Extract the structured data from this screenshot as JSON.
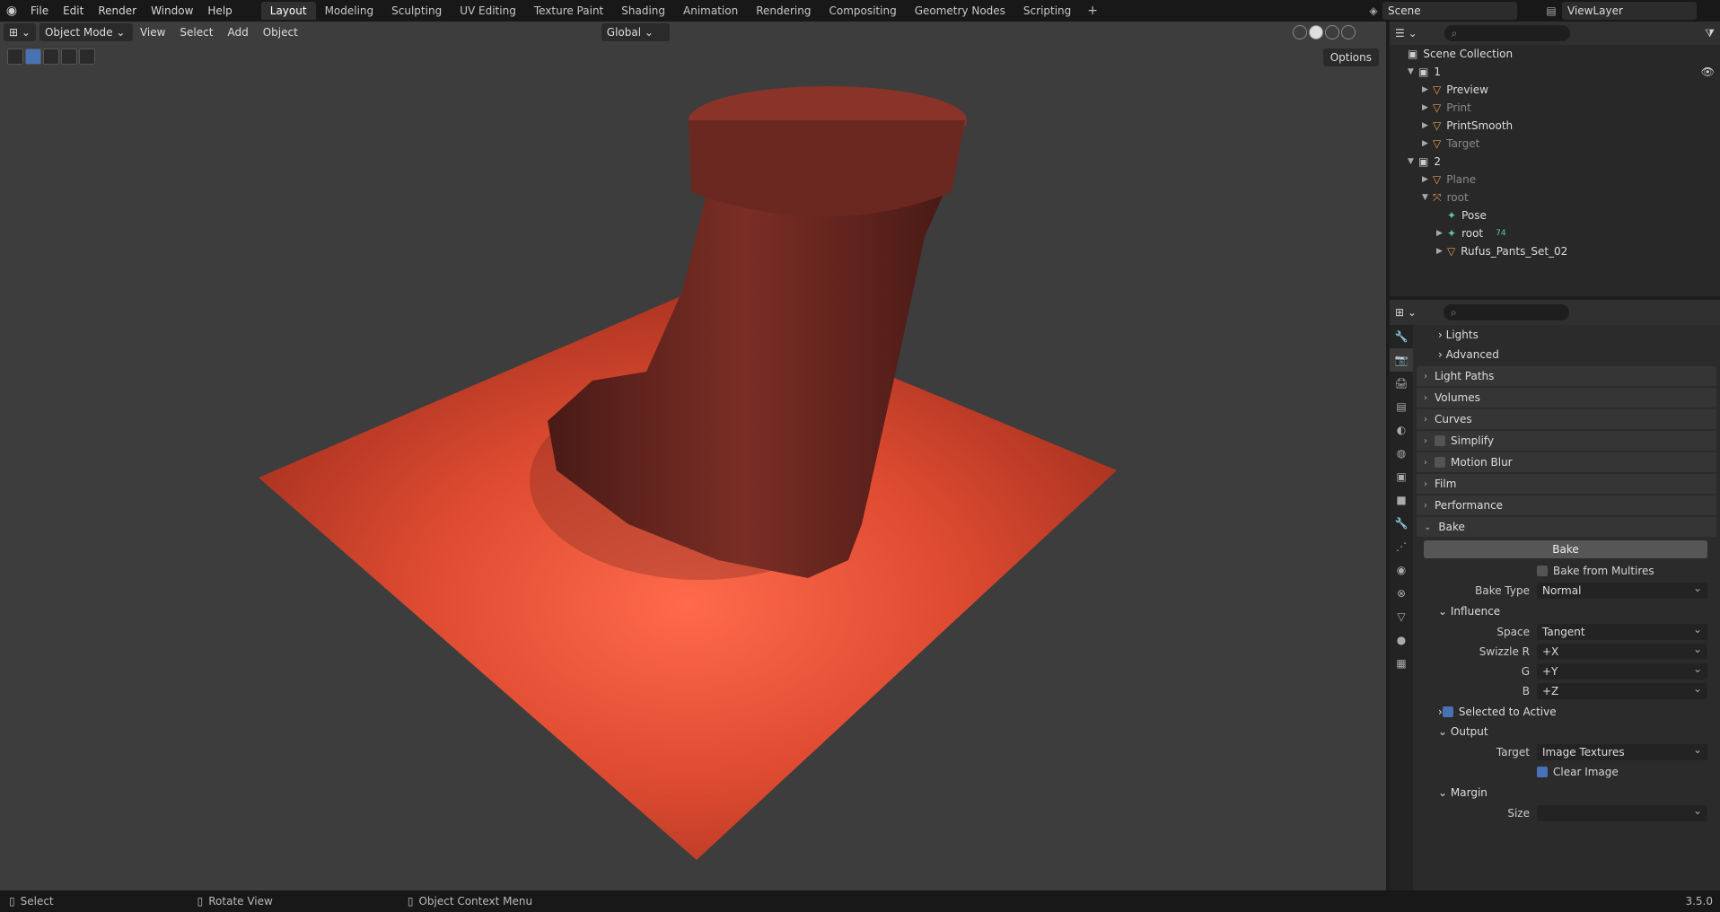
{
  "menu": {
    "items": [
      "File",
      "Edit",
      "Render",
      "Window",
      "Help"
    ]
  },
  "workspaces": [
    "Layout",
    "Modeling",
    "Sculpting",
    "UV Editing",
    "Texture Paint",
    "Shading",
    "Animation",
    "Rendering",
    "Compositing",
    "Geometry Nodes",
    "Scripting"
  ],
  "active_workspace": "Layout",
  "scene": {
    "label": "Scene"
  },
  "viewlayer": {
    "label": "ViewLayer"
  },
  "viewport": {
    "mode": "Object Mode",
    "menus": [
      "View",
      "Select",
      "Add",
      "Object"
    ],
    "transform_orientation": "Global",
    "options_label": "Options"
  },
  "outliner": {
    "title": "Scene Collection",
    "rows": [
      {
        "name": "1",
        "dim": false
      },
      {
        "name": "Preview",
        "dim": false
      },
      {
        "name": "Print",
        "dim": true
      },
      {
        "name": "PrintSmooth",
        "dim": false
      },
      {
        "name": "Target",
        "dim": true
      },
      {
        "name": "2",
        "dim": false
      },
      {
        "name": "Plane",
        "dim": true
      },
      {
        "name": "root",
        "dim": true
      },
      {
        "name": "Pose",
        "dim": false
      },
      {
        "name": "root",
        "dim": false
      },
      {
        "name": "Rufus_Pants_Set_02",
        "dim": false
      }
    ],
    "root_count": "74"
  },
  "properties": {
    "panels_top": [
      "Lights",
      "Advanced"
    ],
    "panels": [
      "Light Paths",
      "Volumes",
      "Curves",
      "Simplify",
      "Motion Blur",
      "Film",
      "Performance",
      "Bake"
    ],
    "bake_button": "Bake",
    "bake_from_multires": "Bake from Multires",
    "bake_type_label": "Bake Type",
    "bake_type_value": "Normal",
    "influence": "Influence",
    "space_label": "Space",
    "space_value": "Tangent",
    "swizzle_r_label": "Swizzle R",
    "swizzle_r_value": "+X",
    "g_label": "G",
    "g_value": "+Y",
    "b_label": "B",
    "b_value": "+Z",
    "selected_to_active": "Selected to Active",
    "output": "Output",
    "target_label": "Target",
    "target_value": "Image Textures",
    "clear_image": "Clear Image",
    "margin": "Margin",
    "size_label": "Size"
  },
  "statusbar": {
    "select": "Select",
    "rotate": "Rotate View",
    "context": "Object Context Menu",
    "version": "3.5.0"
  },
  "colors": {
    "accent": "#4772b3",
    "plane": "#e2543a",
    "boot": "#6e2a22"
  }
}
